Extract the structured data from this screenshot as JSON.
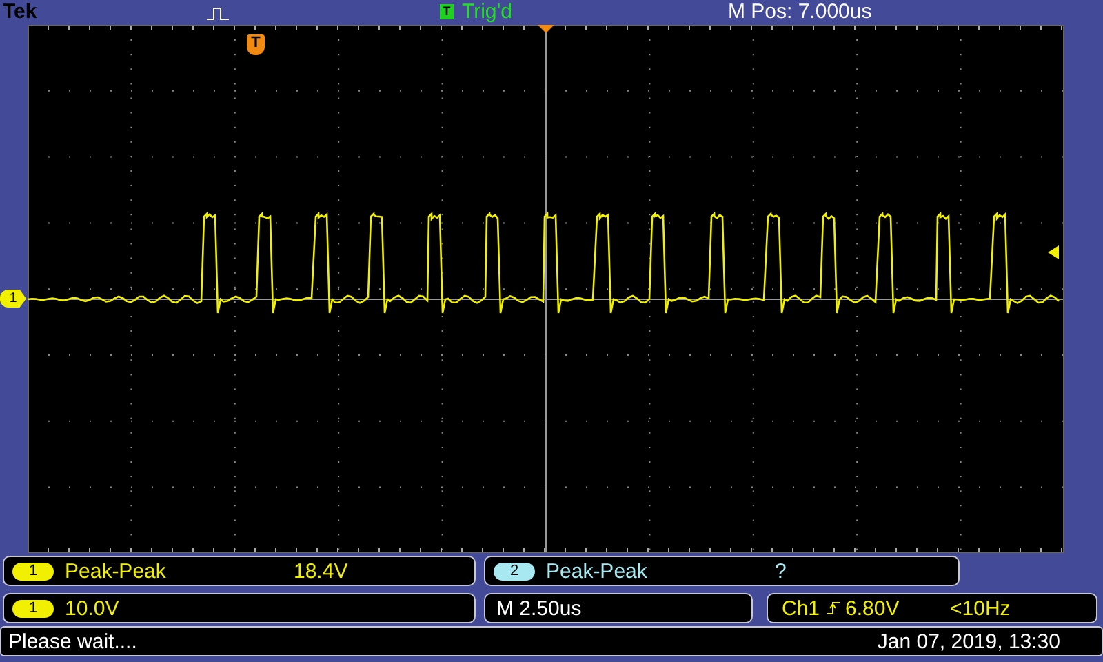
{
  "header": {
    "brand": "Tek",
    "trigger_badge": "T",
    "trigger_status": "Trig'd",
    "position": "M Pos: 7.000us"
  },
  "markers": {
    "trigger_marker": "T",
    "channel_marker": "1"
  },
  "measurements": [
    {
      "channel": "1",
      "label": "Peak-Peak",
      "value": "18.4V",
      "color": "#f0f000"
    },
    {
      "channel": "2",
      "label": "Peak-Peak",
      "value": "?",
      "color": "#a8e8f0"
    }
  ],
  "channel_scale": {
    "channel": "1",
    "value": "10.0V",
    "color": "#f0f000"
  },
  "timebase": "M 2.50us",
  "trigger": {
    "source": "Ch1",
    "level": "6.80V",
    "frequency": "<10Hz"
  },
  "status": {
    "message": "Please wait....",
    "datetime": "Jan 07, 2019, 13:30"
  }
}
